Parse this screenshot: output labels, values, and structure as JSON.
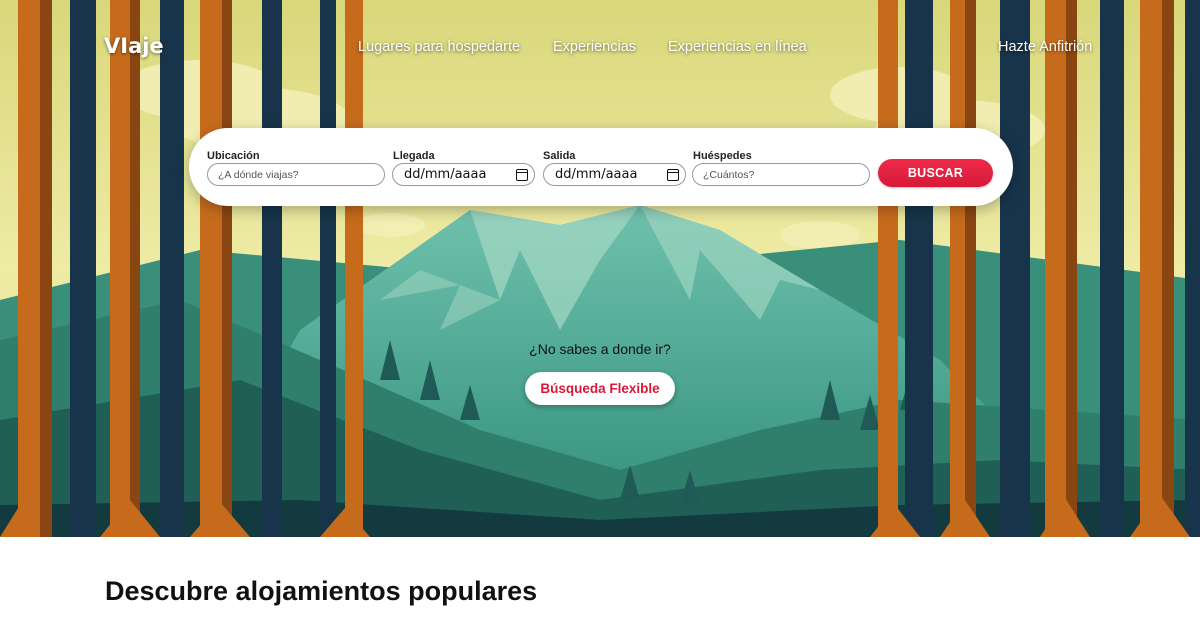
{
  "nav": {
    "logo": "VIaje",
    "links": [
      "Lugares para hospedarte",
      "Experiencias",
      "Experiencias en línea"
    ],
    "host": "Hazte Anfitrión"
  },
  "search": {
    "location": {
      "label": "Ubicación",
      "placeholder": "¿A dónde viajas?"
    },
    "checkin": {
      "label": "Llegada",
      "value": "dd/mm/aaaa"
    },
    "checkout": {
      "label": "Salida",
      "value": "dd/mm/aaaa"
    },
    "guests": {
      "label": "Huéspedes",
      "placeholder": "¿Cuántos?"
    },
    "button": "BUSCAR"
  },
  "flexible": {
    "prompt": "¿No sabes a donde ir?",
    "button": "Búsqueda Flexible"
  },
  "section": {
    "title": "Descubre alojamientos populares"
  },
  "colors": {
    "accent": "#e11d3f",
    "sky": "#e5e48e",
    "mountain": "#3f9f8b",
    "trunk": "#c66b1c",
    "trunk_shadow": "#17344a"
  }
}
